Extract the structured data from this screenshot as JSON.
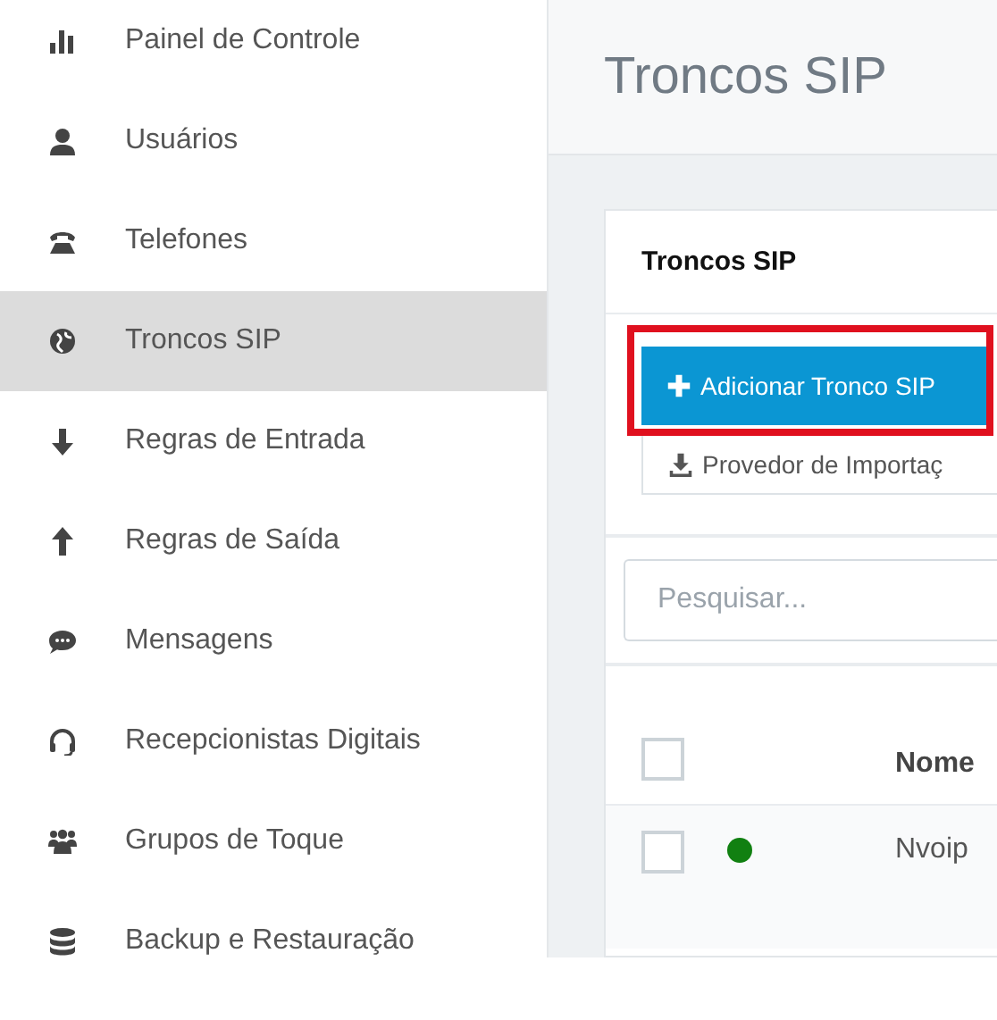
{
  "sidebar": {
    "items": [
      {
        "label": "Painel de Controle",
        "selected": false
      },
      {
        "label": "Usuários",
        "selected": false
      },
      {
        "label": "Telefones",
        "selected": false
      },
      {
        "label": "Troncos SIP",
        "selected": true
      },
      {
        "label": "Regras de Entrada",
        "selected": false
      },
      {
        "label": "Regras de Saída",
        "selected": false
      },
      {
        "label": "Mensagens",
        "selected": false
      },
      {
        "label": "Recepcionistas Digitais",
        "selected": false
      },
      {
        "label": "Grupos de Toque",
        "selected": false
      },
      {
        "label": "Backup e Restauração",
        "selected": false
      }
    ]
  },
  "page": {
    "title": "Troncos SIP"
  },
  "card": {
    "title": "Troncos SIP",
    "add_button": {
      "label": "Adicionar Tronco SIP",
      "highlighted": true
    },
    "menu_items": [
      {
        "label": "Provedor de Importaç"
      }
    ],
    "search": {
      "placeholder": "Pesquisar..."
    },
    "table": {
      "columns": [
        "Nome"
      ],
      "header_checked": false,
      "rows": [
        {
          "checked": false,
          "color": "#118011",
          "name": "Nvoip"
        }
      ]
    }
  }
}
